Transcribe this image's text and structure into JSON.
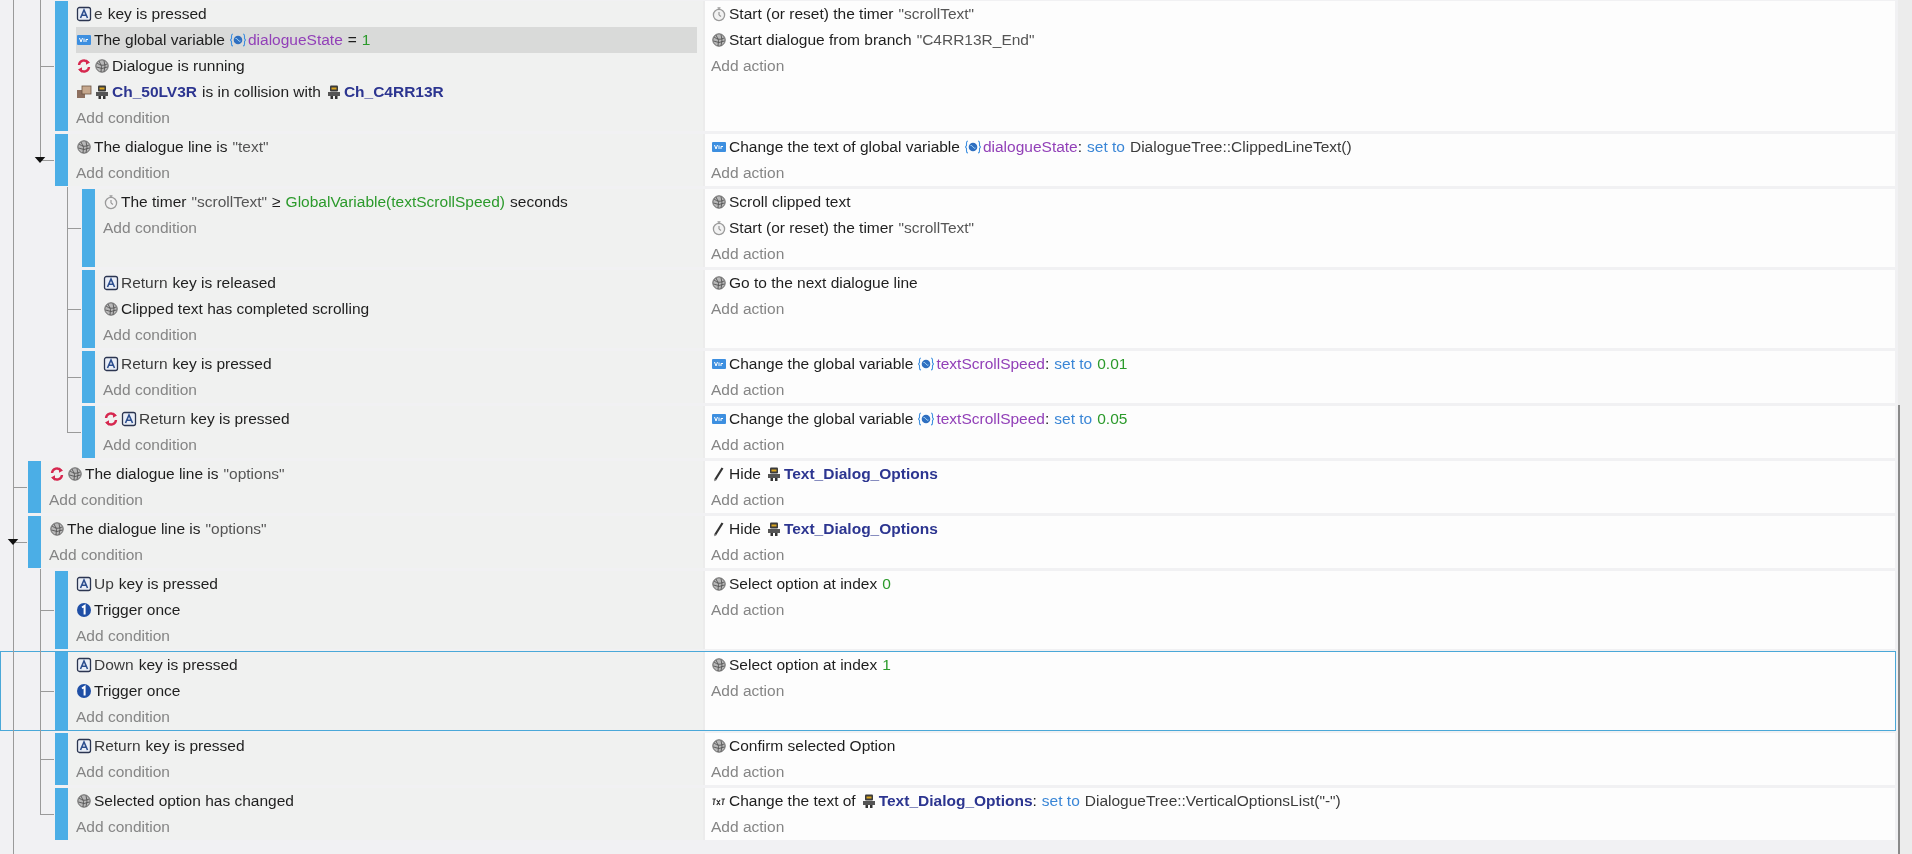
{
  "events": [
    {
      "children": [
        {
          "highlighted": false,
          "add_condition": "Add condition",
          "add_action": "Add action",
          "conditions": [
            {
              "kind": "keyboard",
              "selected": false,
              "inverted": false,
              "parts": [
                {
                  "kind": "param",
                  "text": "e"
                },
                {
                  "kind": "plain",
                  "text": "key is pressed"
                }
              ]
            },
            {
              "kind": "variable",
              "selected": true,
              "inverted": false,
              "parts": [
                {
                  "kind": "plain",
                  "text": "The global variable"
                },
                {
                  "kind": "variable",
                  "text": "dialogueState"
                },
                {
                  "kind": "plain",
                  "text": "="
                },
                {
                  "kind": "number",
                  "text": "1"
                }
              ]
            },
            {
              "kind": "dialogue",
              "selected": false,
              "inverted": true,
              "parts": [
                {
                  "kind": "plain",
                  "text": "Dialogue is running"
                }
              ]
            },
            {
              "kind": "collision",
              "selected": false,
              "inverted": false,
              "parts": [
                {
                  "kind": "object",
                  "text": "Ch_50LV3R"
                },
                {
                  "kind": "plain",
                  "text": "is in collision with"
                },
                {
                  "kind": "object",
                  "text": "Ch_C4RR13R"
                }
              ]
            }
          ],
          "actions": [
            {
              "kind": "timer",
              "parts": [
                {
                  "kind": "plain",
                  "text": "Start (or reset) the timer"
                },
                {
                  "kind": "string",
                  "text": "\"scrollText\""
                }
              ]
            },
            {
              "kind": "dialogue",
              "parts": [
                {
                  "kind": "plain",
                  "text": "Start dialogue from branch"
                },
                {
                  "kind": "string",
                  "text": "\"C4RR13R_End\""
                }
              ]
            }
          ]
        },
        {
          "expanded": true,
          "highlighted": false,
          "add_condition": "Add condition",
          "add_action": "Add action",
          "conditions": [
            {
              "kind": "dialogue",
              "selected": false,
              "inverted": false,
              "parts": [
                {
                  "kind": "plain",
                  "text": "The dialogue line is"
                },
                {
                  "kind": "string",
                  "text": "\"text\""
                }
              ]
            }
          ],
          "actions": [
            {
              "kind": "variable",
              "parts": [
                {
                  "kind": "plain",
                  "text": "Change the text of global variable"
                },
                {
                  "kind": "variable",
                  "text": "dialogueState"
                },
                {
                  "kind": "punct",
                  "text": ":"
                },
                {
                  "kind": "keyword",
                  "text": "set to"
                },
                {
                  "kind": "param",
                  "text": "DialogueTree::ClippedLineText()"
                }
              ]
            }
          ],
          "children": [
            {
              "highlighted": false,
              "add_condition": "Add condition",
              "add_action": "Add action",
              "conditions": [
                {
                  "kind": "timer",
                  "selected": false,
                  "inverted": false,
                  "parts": [
                    {
                      "kind": "plain",
                      "text": "The timer"
                    },
                    {
                      "kind": "string",
                      "text": "\"scrollText\""
                    },
                    {
                      "kind": "plain",
                      "text": "≥"
                    },
                    {
                      "kind": "number",
                      "text": "GlobalVariable(textScrollSpeed)"
                    },
                    {
                      "kind": "plain",
                      "text": "seconds"
                    }
                  ]
                }
              ],
              "actions": [
                {
                  "kind": "dialogue",
                  "parts": [
                    {
                      "kind": "plain",
                      "text": "Scroll clipped text"
                    }
                  ]
                },
                {
                  "kind": "timer",
                  "parts": [
                    {
                      "kind": "plain",
                      "text": "Start (or reset) the timer"
                    },
                    {
                      "kind": "string",
                      "text": "\"scrollText\""
                    }
                  ]
                }
              ]
            },
            {
              "highlighted": false,
              "add_condition": "Add condition",
              "add_action": "Add action",
              "conditions": [
                {
                  "kind": "keyboard",
                  "selected": false,
                  "inverted": false,
                  "parts": [
                    {
                      "kind": "param",
                      "text": "Return"
                    },
                    {
                      "kind": "plain",
                      "text": "key is released"
                    }
                  ]
                },
                {
                  "kind": "dialogue",
                  "selected": false,
                  "inverted": false,
                  "parts": [
                    {
                      "kind": "plain",
                      "text": "Clipped text has completed scrolling"
                    }
                  ]
                }
              ],
              "actions": [
                {
                  "kind": "dialogue",
                  "parts": [
                    {
                      "kind": "plain",
                      "text": "Go to the next dialogue line"
                    }
                  ]
                }
              ]
            },
            {
              "highlighted": false,
              "add_condition": "Add condition",
              "add_action": "Add action",
              "conditions": [
                {
                  "kind": "keyboard",
                  "selected": false,
                  "inverted": false,
                  "parts": [
                    {
                      "kind": "param",
                      "text": "Return"
                    },
                    {
                      "kind": "plain",
                      "text": "key is pressed"
                    }
                  ]
                }
              ],
              "actions": [
                {
                  "kind": "variable",
                  "parts": [
                    {
                      "kind": "plain",
                      "text": "Change the global variable"
                    },
                    {
                      "kind": "variable",
                      "text": "textScrollSpeed"
                    },
                    {
                      "kind": "punct",
                      "text": ":"
                    },
                    {
                      "kind": "keyword",
                      "text": "set to"
                    },
                    {
                      "kind": "number",
                      "text": "0.01"
                    }
                  ]
                }
              ]
            },
            {
              "highlighted": false,
              "add_condition": "Add condition",
              "add_action": "Add action",
              "conditions": [
                {
                  "kind": "keyboard",
                  "selected": false,
                  "inverted": true,
                  "parts": [
                    {
                      "kind": "param",
                      "text": "Return"
                    },
                    {
                      "kind": "plain",
                      "text": "key is pressed"
                    }
                  ]
                }
              ],
              "actions": [
                {
                  "kind": "variable",
                  "parts": [
                    {
                      "kind": "plain",
                      "text": "Change the global variable"
                    },
                    {
                      "kind": "variable",
                      "text": "textScrollSpeed"
                    },
                    {
                      "kind": "punct",
                      "text": ":"
                    },
                    {
                      "kind": "keyword",
                      "text": "set to"
                    },
                    {
                      "kind": "number",
                      "text": "0.05"
                    }
                  ]
                }
              ]
            }
          ]
        }
      ]
    },
    {
      "highlighted": false,
      "add_condition": "Add condition",
      "add_action": "Add action",
      "conditions": [
        {
          "kind": "dialogue",
          "selected": false,
          "inverted": true,
          "parts": [
            {
              "kind": "plain",
              "text": "The dialogue line is"
            },
            {
              "kind": "string",
              "text": "\"options\""
            }
          ]
        }
      ],
      "actions": [
        {
          "kind": "visibility",
          "parts": [
            {
              "kind": "plain",
              "text": "Hide"
            },
            {
              "kind": "object",
              "text": "Text_Dialog_Options"
            }
          ]
        }
      ]
    },
    {
      "expanded": true,
      "highlighted": false,
      "add_condition": "Add condition",
      "add_action": "Add action",
      "conditions": [
        {
          "kind": "dialogue",
          "selected": false,
          "inverted": false,
          "parts": [
            {
              "kind": "plain",
              "text": "The dialogue line is"
            },
            {
              "kind": "string",
              "text": "\"options\""
            }
          ]
        }
      ],
      "actions": [
        {
          "kind": "visibility",
          "parts": [
            {
              "kind": "plain",
              "text": "Hide"
            },
            {
              "kind": "object",
              "text": "Text_Dialog_Options"
            }
          ]
        }
      ],
      "children": [
        {
          "highlighted": false,
          "add_condition": "Add condition",
          "add_action": "Add action",
          "conditions": [
            {
              "kind": "keyboard",
              "selected": false,
              "inverted": false,
              "parts": [
                {
                  "kind": "param",
                  "text": "Up"
                },
                {
                  "kind": "plain",
                  "text": "key is pressed"
                }
              ]
            },
            {
              "kind": "trigger",
              "selected": false,
              "inverted": false,
              "parts": [
                {
                  "kind": "plain",
                  "text": "Trigger once"
                }
              ]
            }
          ],
          "actions": [
            {
              "kind": "dialogue",
              "parts": [
                {
                  "kind": "plain",
                  "text": "Select option at index"
                },
                {
                  "kind": "number",
                  "text": "0"
                }
              ]
            }
          ]
        },
        {
          "highlighted": true,
          "add_condition": "Add condition",
          "add_action": "Add action",
          "conditions": [
            {
              "kind": "keyboard",
              "selected": false,
              "inverted": false,
              "parts": [
                {
                  "kind": "param",
                  "text": "Down"
                },
                {
                  "kind": "plain",
                  "text": "key is pressed"
                }
              ]
            },
            {
              "kind": "trigger",
              "selected": false,
              "inverted": false,
              "parts": [
                {
                  "kind": "plain",
                  "text": "Trigger once"
                }
              ]
            }
          ],
          "actions": [
            {
              "kind": "dialogue",
              "parts": [
                {
                  "kind": "plain",
                  "text": "Select option at index"
                },
                {
                  "kind": "number",
                  "text": "1"
                }
              ]
            }
          ]
        },
        {
          "highlighted": false,
          "add_condition": "Add condition",
          "add_action": "Add action",
          "conditions": [
            {
              "kind": "keyboard",
              "selected": false,
              "inverted": false,
              "parts": [
                {
                  "kind": "param",
                  "text": "Return"
                },
                {
                  "kind": "plain",
                  "text": "key is pressed"
                }
              ]
            }
          ],
          "actions": [
            {
              "kind": "dialogue",
              "parts": [
                {
                  "kind": "plain",
                  "text": "Confirm selected Option"
                }
              ]
            }
          ]
        },
        {
          "highlighted": false,
          "add_condition": "Add condition",
          "add_action": "Add action",
          "conditions": [
            {
              "kind": "dialogue",
              "selected": false,
              "inverted": false,
              "parts": [
                {
                  "kind": "plain",
                  "text": "Selected option has changed"
                }
              ]
            }
          ],
          "actions": [
            {
              "kind": "text",
              "parts": [
                {
                  "kind": "plain",
                  "text": "Change the text of"
                },
                {
                  "kind": "object",
                  "text": "Text_Dialog_Options"
                },
                {
                  "kind": "punct",
                  "text": ":"
                },
                {
                  "kind": "keyword",
                  "text": "set to"
                },
                {
                  "kind": "param",
                  "text": "DialogueTree::VerticalOptionsList(\"-\")"
                }
              ]
            }
          ]
        }
      ]
    }
  ]
}
